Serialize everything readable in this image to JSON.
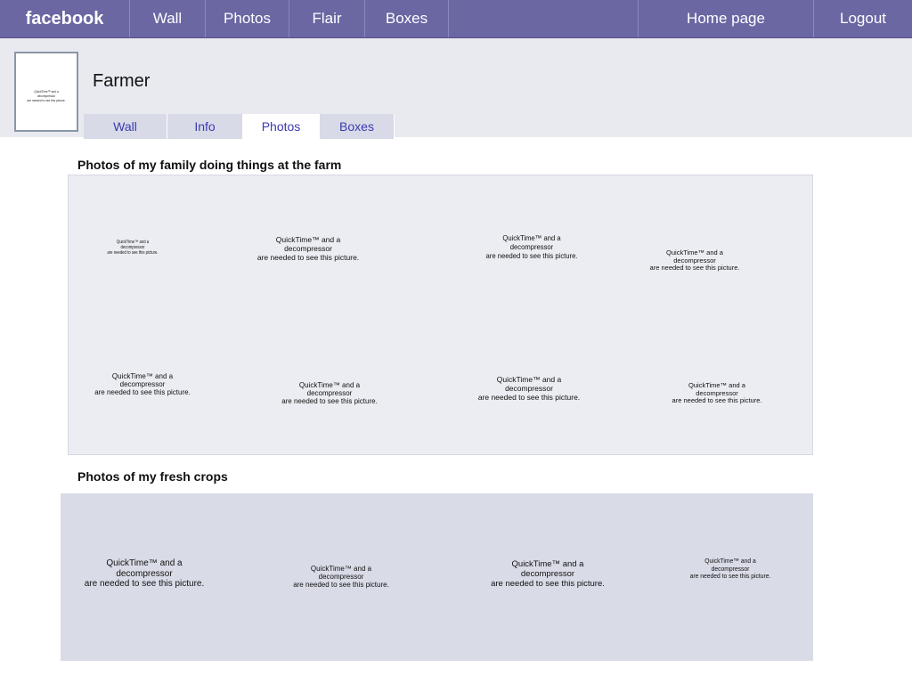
{
  "topbar": {
    "logo": "facebook",
    "nav": [
      "Wall",
      "Photos",
      "Flair",
      "Boxes"
    ],
    "home": "Home page",
    "logout": "Logout"
  },
  "profile": {
    "name": "Farmer",
    "tabs": [
      "Wall",
      "Info",
      "Photos",
      "Boxes"
    ],
    "active_tab": "Photos"
  },
  "placeholder": {
    "line1": "QuickTime™ and a",
    "line2": "decompressor",
    "line3": "are needed to see this picture."
  },
  "sections": {
    "family_title": "Photos of my family doing things at the farm",
    "crops_title": "Photos of my fresh crops"
  },
  "colors": {
    "topbar": "#6a67a3",
    "profile_band": "#e9eaf0",
    "tab_link": "#3b3bb0"
  }
}
